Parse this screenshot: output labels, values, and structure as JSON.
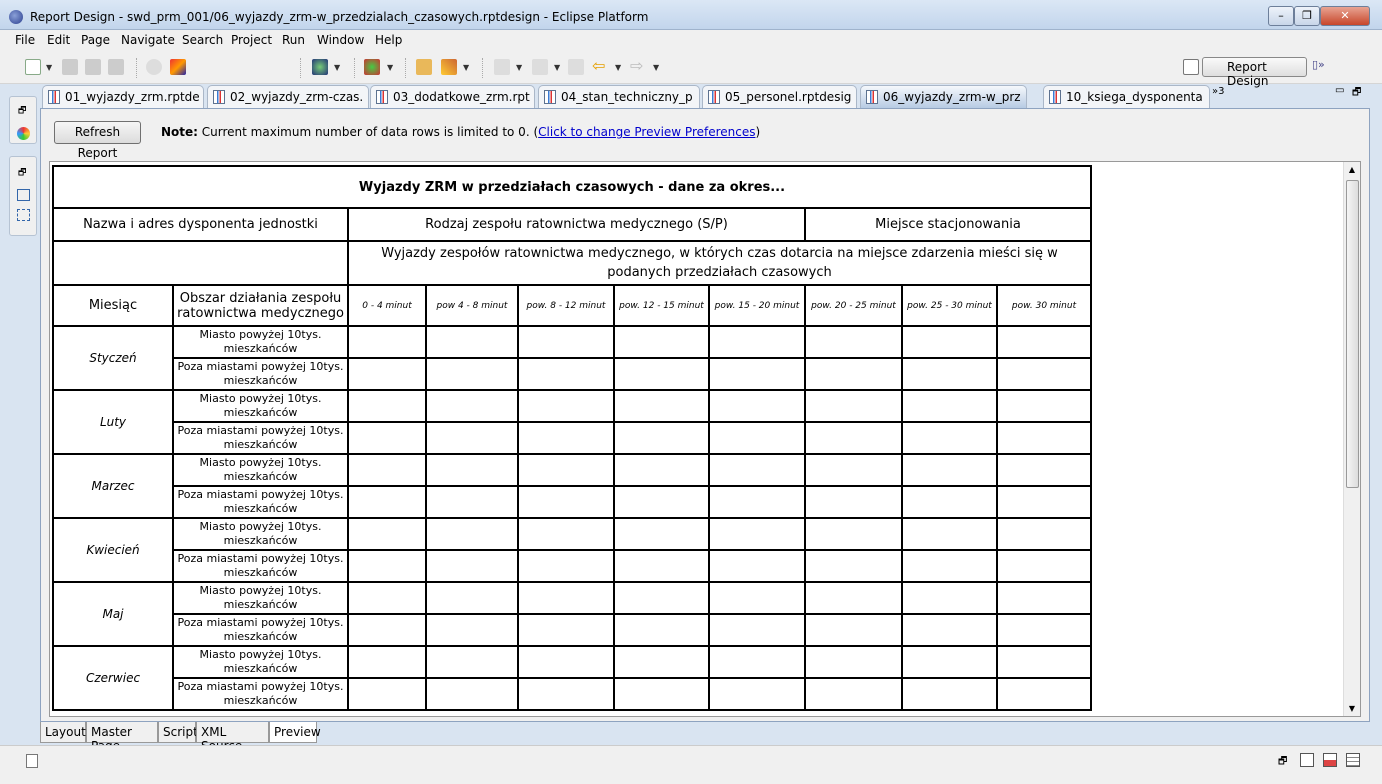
{
  "window": {
    "title": "Report Design - swd_prm_001/06_wyjazdy_zrm-w_przedzialach_czasowych.rptdesign - Eclipse Platform"
  },
  "menu": [
    "File",
    "Edit",
    "Page",
    "Navigate",
    "Search",
    "Project",
    "Run",
    "Window",
    "Help"
  ],
  "perspective": {
    "label": "Report Design"
  },
  "tabs": [
    {
      "label": "01_wyjazdy_zrm.rptde"
    },
    {
      "label": "02_wyjazdy_zrm-czas."
    },
    {
      "label": "03_dodatkowe_zrm.rpt"
    },
    {
      "label": "04_stan_techniczny_p"
    },
    {
      "label": "05_personel.rptdesig"
    },
    {
      "label": "06_wyjazdy_zrm-w_prz",
      "active": true
    },
    {
      "label": "10_ksiega_dysponenta"
    }
  ],
  "tabs_overflow": "»3",
  "preview": {
    "refresh_label": "Refresh Report",
    "note_bold": "Note:",
    "note_text": " Current maximum number of data rows is limited to 0. (",
    "note_link": "Click to change Preview Preferences",
    "note_end": ")"
  },
  "report": {
    "title": "Wyjazdy ZRM w przedziałach czasowych - dane za okres...",
    "col_dysponent": "Nazwa i adres dysponenta jednostki",
    "col_rodzaj": "Rodzaj zespołu ratownictwa medycznego (S/P)",
    "col_miejsce": "Miejsce stacjonowania",
    "subheader": "Wyjazdy zespołów ratownictwa medycznego, w których czas dotarcia na miejsce zdarzenia mieści się w podanych przedziałach czasowych",
    "col_miesiac": "Miesiąc",
    "col_obszar": "Obszar działania zespołu ratownictwa medycznego",
    "intervals": [
      "0 - 4 minut",
      "pow 4 - 8 minut",
      "pow. 8 - 12 minut",
      "pow. 12 - 15 minut",
      "pow. 15 - 20 minut",
      "pow. 20 - 25 minut",
      "pow. 25 - 30 minut",
      "pow. 30 minut"
    ],
    "areas": [
      "Miasto powyżej 10tys. mieszkańców",
      "Poza miastami powyżej 10tys. mieszkańców"
    ],
    "months": [
      "Styczeń",
      "Luty",
      "Marzec",
      "Kwiecień",
      "Maj",
      "Czerwiec"
    ]
  },
  "bottom_tabs": [
    {
      "label": "Layout"
    },
    {
      "label": "Master Page"
    },
    {
      "label": "Script"
    },
    {
      "label": "XML Source"
    },
    {
      "label": "Preview",
      "active": true
    }
  ]
}
